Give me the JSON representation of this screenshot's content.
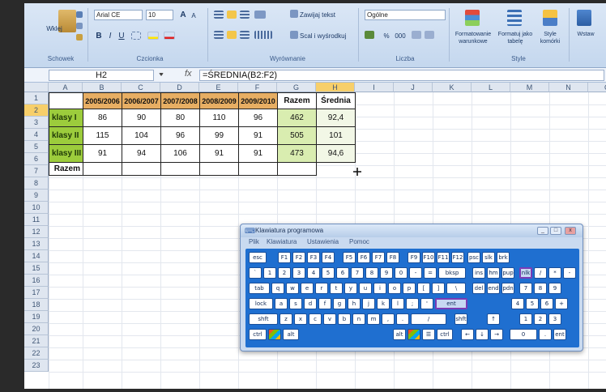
{
  "ribbon": {
    "font_name": "Arial CE",
    "font_size": "10",
    "grow_font": "A",
    "shrink_font": "A",
    "bold": "B",
    "italic": "I",
    "underline": "U",
    "wrap_text": "Zawijaj tekst",
    "merge_center": "Scal i wyśrodkuj",
    "number_format": "Ogólne",
    "percent": "%",
    "thousands": "000",
    "conditional_formatting": "Formatowanie warunkowe",
    "format_as_table": "Formatuj jako tabelę",
    "cell_styles": "Style komórki",
    "insert": "Wstaw",
    "paste": "Wklej",
    "groups": {
      "clipboard": "Schowek",
      "font": "Czcionka",
      "alignment": "Wyrównanie",
      "number": "Liczba",
      "styles": "Style"
    }
  },
  "formula_bar": {
    "name_box": "H2",
    "fx": "fx",
    "formula": "=ŚREDNIA(B2:F2)"
  },
  "grid": {
    "columns": [
      "A",
      "B",
      "C",
      "D",
      "E",
      "F",
      "G",
      "H",
      "I",
      "J",
      "K",
      "L",
      "M",
      "N",
      "O"
    ],
    "rows": [
      "1",
      "2",
      "3",
      "4",
      "5",
      "6",
      "7",
      "8",
      "9",
      "10",
      "11",
      "12",
      "13",
      "14",
      "15",
      "16",
      "17",
      "18",
      "19",
      "20",
      "21",
      "22",
      "23"
    ]
  },
  "table": {
    "years": [
      "2005/2006",
      "2006/2007",
      "2007/2008",
      "2008/2009",
      "2009/2010"
    ],
    "sum_header": "Razem",
    "avg_header": "Średnia",
    "rows": [
      {
        "label": "klasy I",
        "values": [
          "86",
          "90",
          "80",
          "110",
          "96"
        ],
        "sum": "462",
        "avg": "92,4"
      },
      {
        "label": "klasy II",
        "values": [
          "115",
          "104",
          "96",
          "99",
          "91"
        ],
        "sum": "505",
        "avg": "101"
      },
      {
        "label": "klasy III",
        "values": [
          "91",
          "94",
          "106",
          "91",
          "91"
        ],
        "sum": "473",
        "avg": "94,6"
      }
    ],
    "total_label": "Razem"
  },
  "osk": {
    "title": "Klawiatura programowa",
    "menu": [
      "Plik",
      "Klawiatura",
      "Ustawienia",
      "Pomoc"
    ],
    "row0": [
      "esc",
      "F1",
      "F2",
      "F3",
      "F4",
      "F5",
      "F6",
      "F7",
      "F8",
      "F9",
      "F10",
      "F11",
      "F12",
      "psc",
      "slk",
      "brk"
    ],
    "row1": [
      "`",
      "1",
      "2",
      "3",
      "4",
      "5",
      "6",
      "7",
      "8",
      "9",
      "0",
      "-",
      "=",
      "bksp",
      "ins",
      "hm",
      "pup",
      "nlk",
      "/",
      "*",
      "-"
    ],
    "row2": [
      "tab",
      "q",
      "w",
      "e",
      "r",
      "t",
      "y",
      "u",
      "i",
      "o",
      "p",
      "[",
      "]",
      "\\",
      "del",
      "end",
      "pdn",
      "7",
      "8",
      "9"
    ],
    "row3": [
      "lock",
      "a",
      "s",
      "d",
      "f",
      "g",
      "h",
      "j",
      "k",
      "l",
      ";",
      "'",
      "ent",
      "4",
      "5",
      "6",
      "+"
    ],
    "row4": [
      "shft",
      "z",
      "x",
      "c",
      "v",
      "b",
      "n",
      "m",
      ",",
      ".",
      "/",
      "shft",
      "↑",
      "1",
      "2",
      "3"
    ],
    "row5": [
      "ctrl",
      "win",
      "alt",
      "alt",
      "win",
      "menu",
      "ctrl",
      "←",
      "↓",
      "→",
      "0",
      ".",
      "ent"
    ]
  }
}
